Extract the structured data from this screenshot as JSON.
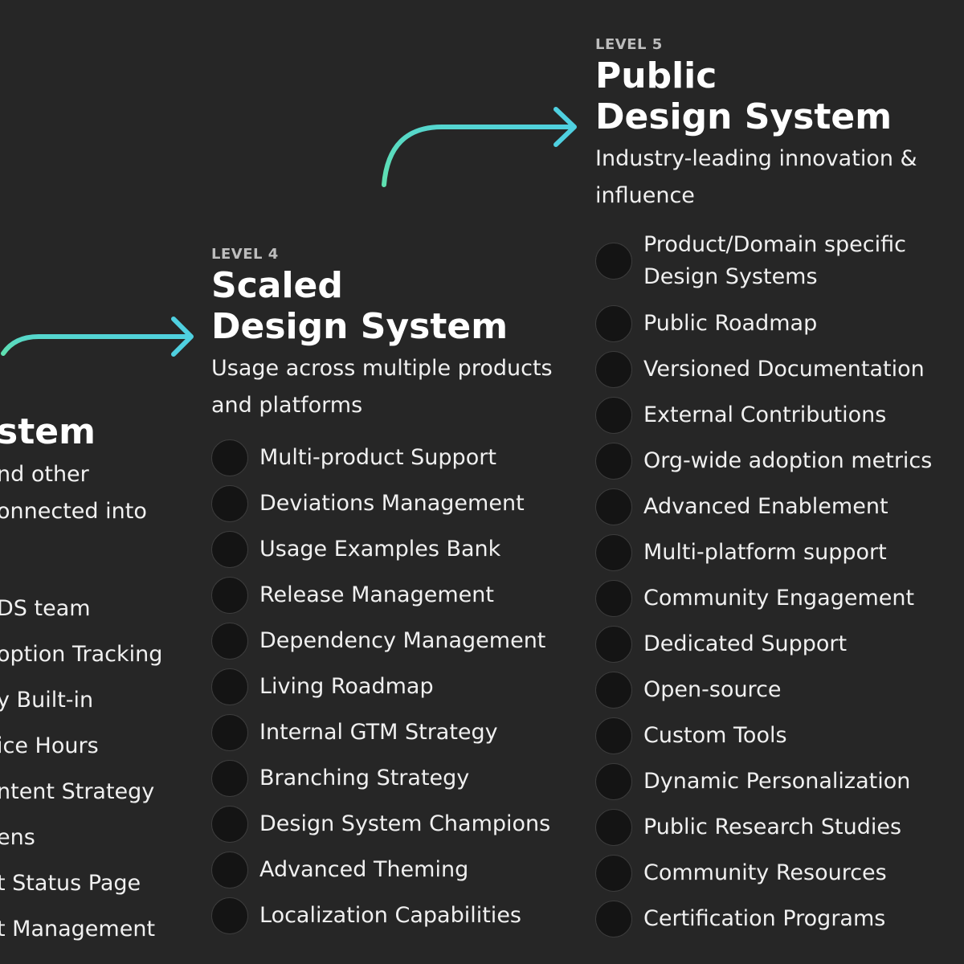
{
  "level3": {
    "title_fragment": "stem",
    "desc_lines": [
      "nd other",
      "onnected into"
    ],
    "items": [
      "DS team",
      "option Tracking",
      "y Built-in",
      "ice Hours",
      "ntent Strategy",
      "ens",
      "t Status Page",
      "t Management"
    ]
  },
  "level4": {
    "label": "LEVEL 4",
    "title_line1": "Scaled",
    "title_line2": "Design System",
    "desc": "Usage across multiple products and platforms",
    "items": [
      "Multi-product Support",
      "Deviations Management",
      "Usage Examples Bank",
      "Release Management",
      "Dependency Management",
      "Living Roadmap",
      "Internal GTM Strategy",
      "Branching Strategy",
      "Design System Champions",
      "Advanced Theming",
      "Localization Capabilities"
    ]
  },
  "level5": {
    "label": "LEVEL 5",
    "title_line1": "Public",
    "title_line2": "Design System",
    "desc": "Industry-leading innovation & influence",
    "items": [
      "Product/Domain specific Design Systems",
      "Public Roadmap",
      "Versioned Documentation",
      "External Contributions",
      "Org-wide adoption metrics",
      "Advanced Enablement",
      "Multi-platform support",
      "Community Engagement",
      "Dedicated Support",
      "Open-source",
      "Custom Tools",
      "Dynamic Personalization",
      "Public Research Studies",
      "Community Resources",
      "Certification Programs"
    ]
  },
  "colors": {
    "background": "#262626",
    "arrow_start": "#5fe0b0",
    "arrow_end": "#4fcfe0",
    "circle_fill": "#141414"
  }
}
